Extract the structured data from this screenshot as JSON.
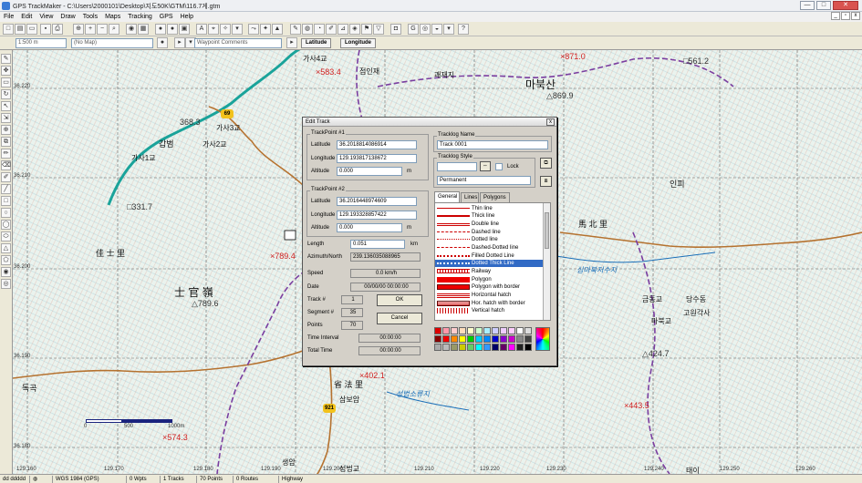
{
  "window": {
    "title": "GPS TrackMaker - C:\\Users\\2000101\\Desktop\\지도50K\\GTM\\116.7게.gtm",
    "controls": {
      "minimize": "—",
      "maximize": "□",
      "close": "✕"
    }
  },
  "menu": [
    "File",
    "Edit",
    "View",
    "Draw",
    "Tools",
    "Maps",
    "Tracking",
    "GPS",
    "Help"
  ],
  "toolbar2": {
    "scale": "1:500 m",
    "map_selector": "(No Map)",
    "waypoint_comments": "Waypoint Comments",
    "latitude_label": "Latitude",
    "longitude_label": "Longitude"
  },
  "map": {
    "labels": [
      {
        "text": "가사4교",
        "cls": "sm"
      },
      {
        "text": "×583.4",
        "cls": "red"
      },
      {
        "text": "점인재",
        "cls": "sm"
      },
      {
        "text": "괘재지",
        "cls": "sm"
      },
      {
        "text": "×871.0",
        "cls": "red"
      },
      {
        "text": "□561.2",
        "cls": "dark"
      },
      {
        "text": "마북산",
        "cls": "big"
      },
      {
        "text": "△869.9",
        "cls": "dark"
      },
      {
        "text": "368.3",
        "cls": "dark"
      },
      {
        "text": "가사3교",
        "cls": "sm"
      },
      {
        "text": "갑범",
        "cls": "med"
      },
      {
        "text": "가사2교",
        "cls": "sm"
      },
      {
        "text": "가사1교",
        "cls": "sm"
      },
      {
        "text": "인피",
        "cls": "med"
      },
      {
        "text": "□331.7",
        "cls": "dark"
      },
      {
        "text": "馬 北 里",
        "cls": "med"
      },
      {
        "text": "佳 士 里",
        "cls": "med"
      },
      {
        "text": "×789.4",
        "cls": "red"
      },
      {
        "text": "심마북저수지",
        "cls": "blue"
      },
      {
        "text": "士 官 嶺",
        "cls": "big"
      },
      {
        "text": "△789.6",
        "cls": "dark"
      },
      {
        "text": "금동교",
        "cls": "sm"
      },
      {
        "text": "당수동",
        "cls": "sm"
      },
      {
        "text": "마북교",
        "cls": "sm"
      },
      {
        "text": "고원각사",
        "cls": "sm"
      },
      {
        "text": "△424.7",
        "cls": "dark"
      },
      {
        "text": "×402.1",
        "cls": "red"
      },
      {
        "text": "省 法 里",
        "cls": "med"
      },
      {
        "text": "삼보암",
        "cls": "sm"
      },
      {
        "text": "성법소류지",
        "cls": "blue"
      },
      {
        "text": "독곡",
        "cls": "med"
      },
      {
        "text": "×443.5",
        "cls": "red"
      },
      {
        "text": "×574.3",
        "cls": "red"
      },
      {
        "text": "생암",
        "cls": "sm"
      },
      {
        "text": "성법교",
        "cls": "sm"
      },
      {
        "text": "태이",
        "cls": "sm"
      }
    ],
    "road_badges": [
      "69",
      "921"
    ],
    "grid_lat": [
      "36.220",
      "36.210",
      "36.200",
      "36.190",
      "36.180"
    ],
    "grid_lon": [
      "129.160",
      "129.170",
      "129.180",
      "129.190",
      "129.200",
      "129.210",
      "129.220",
      "129.230",
      "129.240",
      "129.250",
      "129.260"
    ],
    "scale": {
      "zero": "0",
      "mid": "500",
      "end": "1000m"
    }
  },
  "dialog": {
    "title": "Edit Track",
    "tp1": {
      "group": "TrackPoint #1",
      "lat_label": "Latitude",
      "lat": "36.2018814086914",
      "lon_label": "Longitude",
      "lon": "129.193817138672",
      "alt_label": "Altitude",
      "alt": "0.000",
      "unit": "m"
    },
    "tp2": {
      "group": "TrackPoint #2",
      "lat_label": "Latitude",
      "lat": "36.2016448974609",
      "lon_label": "Longitude",
      "lon": "129.193328857422",
      "alt_label": "Altitude",
      "alt": "0.000",
      "unit": "m"
    },
    "length_label": "Length",
    "length": "0.051",
    "length_unit": "km",
    "azimuth_label": "Azimuth/North",
    "azimuth": "239.136035088965",
    "speed_label": "Speed",
    "speed": "0.0 km/h",
    "date_label": "Date",
    "date": "00/00/00 00:00:00",
    "track_label": "Track #",
    "track": "1",
    "segment_label": "Segment #",
    "segment": "35",
    "points_label": "Points",
    "points": "70",
    "interval_label": "Time Interval",
    "interval": "00:00:00",
    "total_label": "Total Time",
    "total": "00:00:00",
    "ok": "OK",
    "cancel": "Cancel",
    "tracklog_name_group": "Tracklog Name",
    "tracklog_name": "Track 0001",
    "tracklog_style_group": "Tracklog Style",
    "lock_label": "Lock",
    "permanence": "Permanent",
    "tabs": [
      "General",
      "Lines",
      "Polygons"
    ],
    "styles": [
      "Thin line",
      "Thick line",
      "Double line",
      "Dashed line",
      "Dotted line",
      "Dashed-Dotted line",
      "Filled Dotted Line",
      "Dotted Thick Line",
      "Railway",
      "Polygon",
      "Polygon with border",
      "Horizontal hatch",
      "Hor. hatch with border",
      "Vertical hatch"
    ],
    "selected_style": "Dotted Thick Line"
  },
  "status": {
    "coords": "dd ddddd",
    "datum": "WGS 1984 (GPS)",
    "wpts": "0 Wpts",
    "tracks": "1 Tracks",
    "points": "70 Points",
    "routes": "0 Routes",
    "road": "Highway"
  },
  "colors": {
    "track_purple": "#7a3ea0",
    "road_teal": "#1aa39a",
    "road_brown": "#b5722f",
    "highlight": "#316ac5"
  }
}
